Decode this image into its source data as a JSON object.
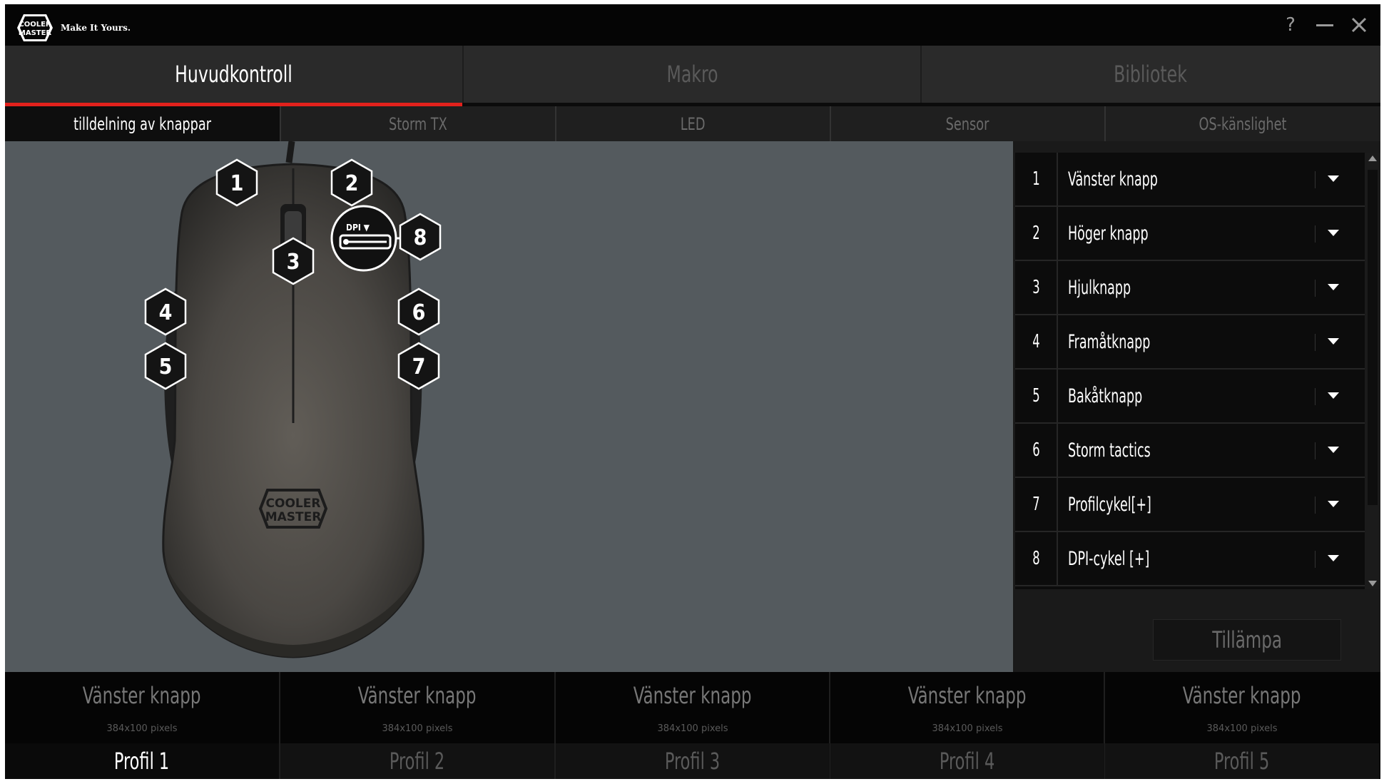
{
  "header": {
    "logo_text": "COOLER MASTER",
    "tagline": "Make It Yours.",
    "help_symbol": "?",
    "minimize_icon": "minimize-icon",
    "close_icon": "close-icon"
  },
  "main_tabs": [
    {
      "label": "Huvudkontroll",
      "active": true
    },
    {
      "label": "Makro",
      "active": false
    },
    {
      "label": "Bibliotek",
      "active": false
    }
  ],
  "sub_tabs": [
    {
      "label": "tilldelning av knappar",
      "active": true
    },
    {
      "label": "Storm TX",
      "active": false
    },
    {
      "label": "LED",
      "active": false
    },
    {
      "label": "Sensor",
      "active": false
    },
    {
      "label": "OS-känslighet",
      "active": false
    }
  ],
  "mouse_diagram": {
    "buttons": [
      "1",
      "2",
      "3",
      "4",
      "5",
      "6",
      "7",
      "8"
    ],
    "dpi_label": "DPI",
    "body_logo": "COOLER MASTER"
  },
  "assignments": [
    {
      "num": "1",
      "label": "Vänster knapp"
    },
    {
      "num": "2",
      "label": "Höger knapp"
    },
    {
      "num": "3",
      "label": "Hjulknapp"
    },
    {
      "num": "4",
      "label": "Framåtknapp"
    },
    {
      "num": "5",
      "label": "Bakåtknapp"
    },
    {
      "num": "6",
      "label": "Storm tactics"
    },
    {
      "num": "7",
      "label": "Profilcykel[+]"
    },
    {
      "num": "8",
      "label": "DPI-cykel [+]"
    }
  ],
  "apply_label": "Tillämpa",
  "profile_slots": [
    {
      "name": "Vänster knapp",
      "size": "384x100 pixels"
    },
    {
      "name": "Vänster knapp",
      "size": "384x100 pixels"
    },
    {
      "name": "Vänster knapp",
      "size": "384x100 pixels"
    },
    {
      "name": "Vänster knapp",
      "size": "384x100 pixels"
    },
    {
      "name": "Vänster knapp",
      "size": "384x100 pixels"
    }
  ],
  "profiles": [
    {
      "label": "Profil 1",
      "active": true
    },
    {
      "label": "Profil 2",
      "active": false
    },
    {
      "label": "Profil 3",
      "active": false
    },
    {
      "label": "Profil 4",
      "active": false
    },
    {
      "label": "Profil 5",
      "active": false
    }
  ],
  "colors": {
    "accent_red": "#e2211c",
    "stage_bg": "#545a5e",
    "panel_bg": "#0c0c0c"
  }
}
